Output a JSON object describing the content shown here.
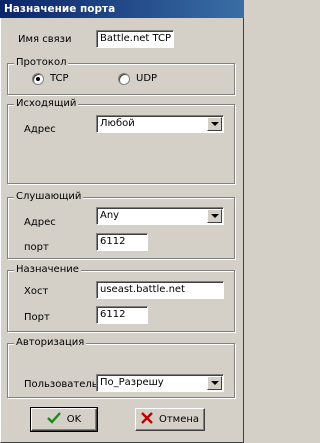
{
  "window": {
    "title": "Назначение порта"
  },
  "name_field": {
    "label": "Имя связи",
    "value": "Battle.net TCP"
  },
  "protocol": {
    "title": "Протокол",
    "options": [
      {
        "label": "TCP",
        "checked": true
      },
      {
        "label": "UDP",
        "checked": false
      }
    ]
  },
  "outgoing": {
    "title": "Исходящий",
    "address_label": "Адрес",
    "address_value": "Любой"
  },
  "listening": {
    "title": "Слушающий",
    "address_label": "Адрес",
    "address_value": "Any",
    "port_label": "порт",
    "port_value": "6112"
  },
  "destination": {
    "title": "Назначение",
    "host_label": "Хост",
    "host_value": "useast.battle.net",
    "port_label": "Порт",
    "port_value": "6112"
  },
  "authorization": {
    "title": "Авторизация",
    "user_label": "Пользователь",
    "user_value": "По_Разрешу"
  },
  "buttons": {
    "ok": "OK",
    "cancel": "Отмена"
  },
  "colors": {
    "title_bar": "#0a246a",
    "face": "#d4d0c8",
    "ok_check": "#1a8a1a",
    "cancel_x": "#c00000"
  },
  "icons": {
    "ok": "check-icon",
    "cancel": "x-icon"
  }
}
